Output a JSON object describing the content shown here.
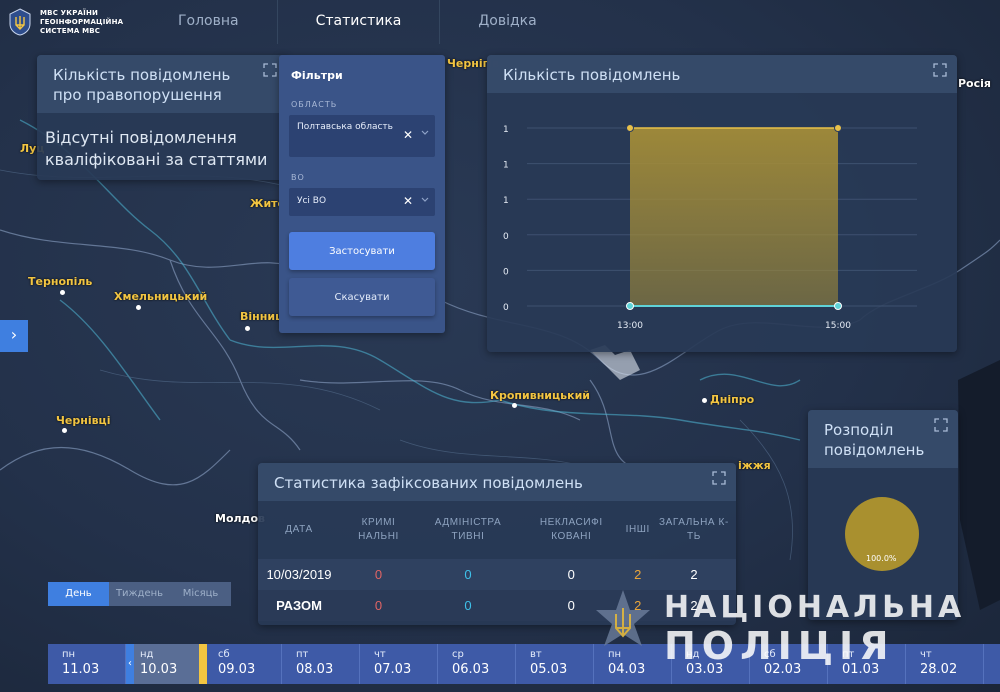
{
  "header": {
    "logo_lines": [
      "МВС УКРАЇНИ",
      "ГЕОІНФОРМАЦІЙНА",
      "СИСТЕМА МВС"
    ],
    "nav": [
      {
        "label": "Головна",
        "active": false
      },
      {
        "label": "Статистика",
        "active": true
      },
      {
        "label": "Довідка",
        "active": false
      }
    ]
  },
  "map": {
    "cities": [
      {
        "name": "Чернігів"
      },
      {
        "name": "Житом"
      },
      {
        "name": "Луц"
      },
      {
        "name": "Тернопіль"
      },
      {
        "name": "Хмельницький"
      },
      {
        "name": "Вінниця"
      },
      {
        "name": "Чернівці"
      },
      {
        "name": "Кропивницький"
      },
      {
        "name": "Дніпро"
      },
      {
        "name": "іжжя"
      },
      {
        "name": "Молдов"
      },
      {
        "name": "Росія"
      }
    ]
  },
  "violations_panel": {
    "title": "Кількість повідомлень про правопорушення",
    "message": "Відсутні повідомлення кваліфіковані за статтями"
  },
  "filters": {
    "title": "Фільтри",
    "region_label": "ОБЛАСТЬ",
    "region_value": "Полтавська область",
    "vo_label": "ВО",
    "vo_value": "Усі ВО",
    "clear_symbol": "✕",
    "apply_label": "Застосувати",
    "cancel_label": "Скасувати"
  },
  "count_panel": {
    "title": "Кількість повідомлень"
  },
  "chart_data": {
    "type": "area",
    "title": "Кількість повідомлень",
    "x": [
      "13:00",
      "15:00"
    ],
    "series": [
      {
        "values": [
          1,
          1
        ]
      }
    ],
    "y_tick_labels": [
      "1",
      "1",
      "1",
      "0",
      "0",
      "0"
    ],
    "ylim": [
      0,
      1
    ],
    "fill_color": "#a38c38",
    "line_color": "#e8c14a",
    "baseline_color": "#5fd3d8",
    "grid": true
  },
  "distribution_panel": {
    "title": "Розподіл повідомлень",
    "pie_label": "100.0%",
    "pie_color": "#a9902f"
  },
  "stats_panel": {
    "title": "Статистика зафіксованих повідомлень",
    "columns": [
      "ДАТА",
      "КРИМІ НАЛЬНІ",
      "АДМІНІСТРА ТИВНІ",
      "НЕКЛАСИФІ КОВАНІ",
      "ІНШІ",
      "ЗАГАЛЬНА К-ТЬ"
    ],
    "rows": [
      {
        "date": "10/03/2019",
        "criminal": "0",
        "admin": "0",
        "unclassified": "0",
        "other": "2",
        "total": "2"
      }
    ],
    "total_row": {
      "label": "РАЗОМ",
      "criminal": "0",
      "admin": "0",
      "unclassified": "0",
      "other": "2",
      "total": "2"
    }
  },
  "side_tab": {
    "symbol": "›"
  },
  "period": {
    "day": "День",
    "week": "Тиждень",
    "month": "Місяць"
  },
  "timeline": {
    "days": [
      {
        "dw": "пн",
        "dd": "11.03"
      },
      {
        "dw": "нд",
        "dd": "10.03"
      },
      {
        "dw": "сб",
        "dd": "09.03"
      },
      {
        "dw": "пт",
        "dd": "08.03"
      },
      {
        "dw": "чт",
        "dd": "07.03"
      },
      {
        "dw": "ср",
        "dd": "06.03"
      },
      {
        "dw": "вт",
        "dd": "05.03"
      },
      {
        "dw": "пн",
        "dd": "04.03"
      },
      {
        "dw": "нд",
        "dd": "03.03"
      },
      {
        "dw": "сб",
        "dd": "02.03"
      },
      {
        "dw": "пт",
        "dd": "01.03"
      },
      {
        "dw": "чт",
        "dd": "28.02"
      }
    ],
    "selected_index": 1,
    "handle_left_symbol": "‹"
  },
  "watermark": {
    "line1": "НАЦІОНАЛЬНА",
    "line2": "ПОЛІЦІЯ"
  },
  "colors": {
    "accent": "#3f7fe0",
    "gold": "#f2c542"
  }
}
